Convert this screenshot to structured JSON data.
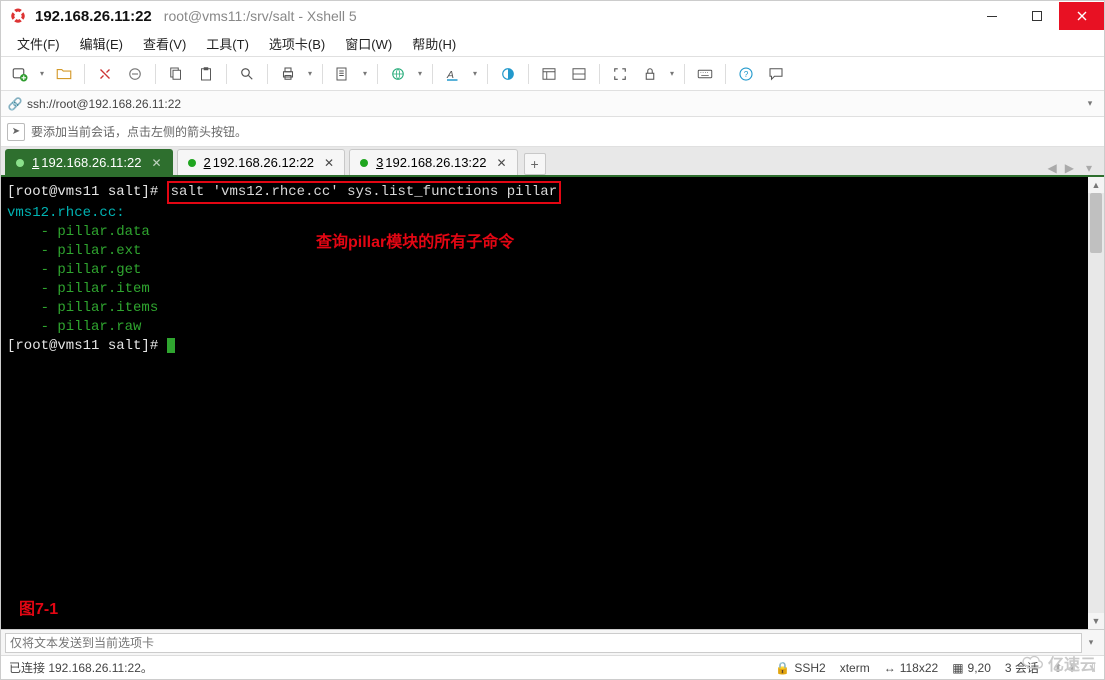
{
  "window": {
    "title_main": "192.168.26.11:22",
    "title_sub": "root@vms11:/srv/salt - Xshell 5"
  },
  "menu": {
    "file": "文件(F)",
    "edit": "编辑(E)",
    "view": "查看(V)",
    "tools": "工具(T)",
    "tab": "选项卡(B)",
    "window": "窗口(W)",
    "help": "帮助(H)"
  },
  "addressbar": {
    "value": "ssh://root@192.168.26.11:22"
  },
  "infobar": {
    "text": "要添加当前会话，点击左侧的箭头按钮。"
  },
  "tabs": [
    {
      "num": "1",
      "label": "192.168.26.11:22",
      "active": true
    },
    {
      "num": "2",
      "label": "192.168.26.12:22",
      "active": false
    },
    {
      "num": "3",
      "label": "192.168.26.13:22",
      "active": false
    }
  ],
  "terminal": {
    "prompt1": "[root@vms11 salt]# ",
    "cmd": "salt 'vms12.rhce.cc' sys.list_functions pillar",
    "minion_line": "vms12.rhce.cc:",
    "items": [
      "    - pillar.data",
      "    - pillar.ext",
      "    - pillar.get",
      "    - pillar.item",
      "    - pillar.items",
      "    - pillar.raw"
    ],
    "prompt2": "[root@vms11 salt]# ",
    "annotation1": "查询pillar模块的所有子命令",
    "annotation2": "图7-1"
  },
  "bottom_input": {
    "placeholder": "仅将文本发送到当前选项卡"
  },
  "status": {
    "connected": "已连接 192.168.26.11:22。",
    "proto": "SSH2",
    "term": "xterm",
    "size": "118x22",
    "cursor": "9,20",
    "sessions": "3 会话"
  },
  "watermark": "亿速云"
}
